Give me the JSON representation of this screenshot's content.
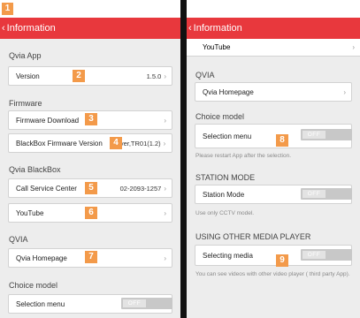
{
  "badges": [
    "1",
    "2",
    "3",
    "4",
    "5",
    "6",
    "7",
    "8",
    "9"
  ],
  "left": {
    "header": {
      "back_icon": "chevron-left",
      "title": "Information"
    },
    "sections": {
      "qvia_app": "Qvia App",
      "firmware": "Firmware",
      "qvia_blackbox": "Qvia BlackBox",
      "qvia": "QVIA",
      "choice_model": "Choice model"
    },
    "rows": {
      "version": {
        "label": "Version",
        "value": "1.5.0"
      },
      "firmware_download": {
        "label": "Firmware Download"
      },
      "blackbox_firmware_version": {
        "label": "BlackBox Firmware Version",
        "value": "ver,TR01(1.2)"
      },
      "call_service_center": {
        "label": "Call Service Center",
        "value": "02-2093-1257"
      },
      "youtube": {
        "label": "YouTube"
      },
      "qvia_homepage": {
        "label": "Qvia Homepage"
      },
      "selection_menu": {
        "label": "Selection menu",
        "toggle": "OFF"
      }
    }
  },
  "right": {
    "header": {
      "back_icon": "chevron-left",
      "title": "Information"
    },
    "rows": {
      "youtube": {
        "label": "YouTube"
      },
      "qvia_homepage": {
        "label": "Qvia Homepage"
      },
      "selection_menu": {
        "label": "Selection menu",
        "toggle": "OFF"
      },
      "station_mode": {
        "label": "Station Mode",
        "toggle": "OFF"
      },
      "selecting_media": {
        "label": "Selecting media",
        "toggle": "OFF"
      }
    },
    "sections": {
      "qvia": "QVIA",
      "choice_model": "Choice model",
      "station_mode": "STATION MODE",
      "using_other_media_player": "USING OTHER MEDIA PLAYER"
    },
    "notes": {
      "restart": "Please restart App after the selection.",
      "cctv": "Use only CCTV model.",
      "other_player": "You can see videos with other video player ( third party App)."
    }
  },
  "colors": {
    "header": "#e8383d",
    "badge": "#f39a4a",
    "background": "#ededed"
  }
}
